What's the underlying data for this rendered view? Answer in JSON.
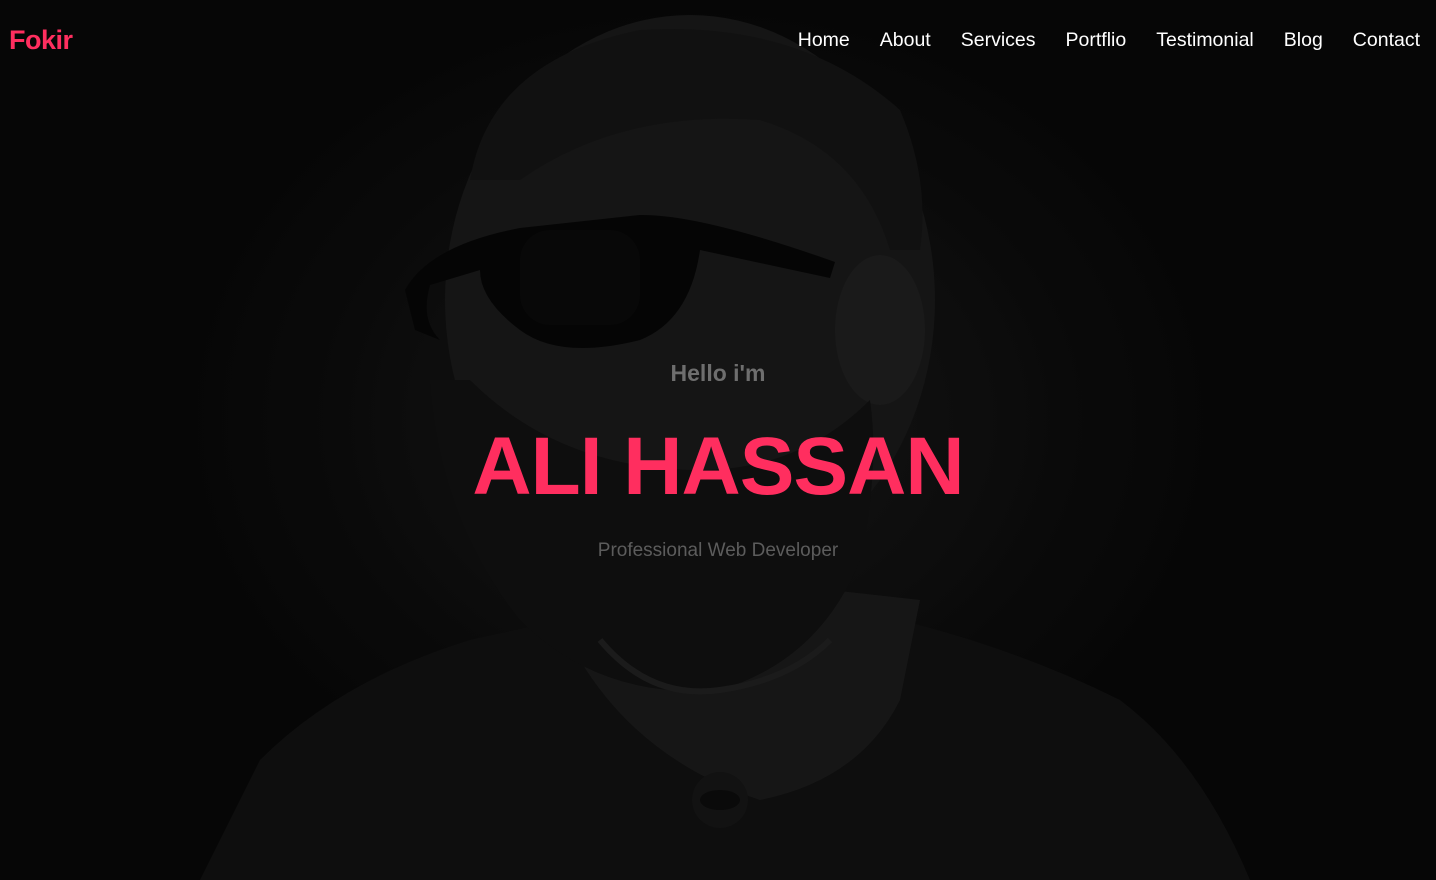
{
  "brand": {
    "logo_text": "Fokir",
    "accent_color": "#ff2e5f"
  },
  "nav": {
    "items": [
      {
        "label": "Home"
      },
      {
        "label": "About"
      },
      {
        "label": "Services"
      },
      {
        "label": "Portflio"
      },
      {
        "label": "Testimonial"
      },
      {
        "label": "Blog"
      },
      {
        "label": "Contact"
      }
    ]
  },
  "hero": {
    "greeting": "Hello i'm",
    "name": "ALI HASSAN",
    "subtitle": "Professional Web Developer",
    "background_image": "portrait-man-sunglasses-beard"
  }
}
